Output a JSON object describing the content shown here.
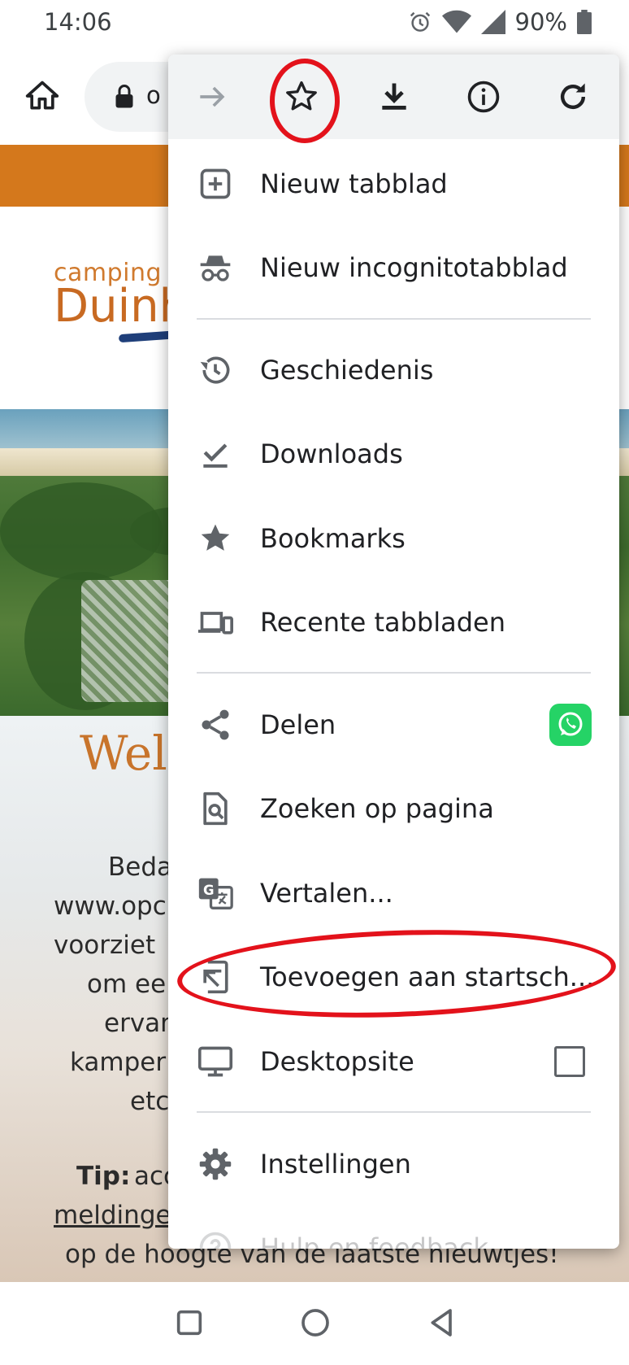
{
  "status_bar": {
    "time": "14:06",
    "battery": "90%"
  },
  "toolbar": {
    "url_partial": "o"
  },
  "page": {
    "logo_small": "camping",
    "logo_big": "Duinh",
    "heading_partial": "Wel",
    "lines": [
      "Beda",
      "www.opc",
      "voorziet ",
      "om ee",
      "ervar",
      "kamper",
      "etc"
    ],
    "tip_label": "Tip:",
    "tip_partial": " acc",
    "link_partial": "meldinge",
    "bottom_line": "op de hoogte van de laatste nieuwtjes!"
  },
  "menu": {
    "items": [
      {
        "label": "Nieuw tabblad"
      },
      {
        "label": "Nieuw incognitotabblad"
      },
      {
        "label": "Geschiedenis"
      },
      {
        "label": "Downloads"
      },
      {
        "label": "Bookmarks"
      },
      {
        "label": "Recente tabbladen"
      },
      {
        "label": "Delen"
      },
      {
        "label": "Zoeken op pagina"
      },
      {
        "label": "Vertalen..."
      },
      {
        "label": "Toevoegen aan startsch..."
      },
      {
        "label": "Desktopsite"
      },
      {
        "label": "Instellingen"
      },
      {
        "label": "Hulp en feedback"
      }
    ]
  },
  "colors": {
    "accent_orange": "#d4781c",
    "annotation_red": "#e3121b",
    "whatsapp_green": "#25d366"
  },
  "icons": [
    "home-icon",
    "lock-icon",
    "forward-icon",
    "bookmark-star-icon",
    "download-icon",
    "info-icon",
    "reload-icon"
  ]
}
